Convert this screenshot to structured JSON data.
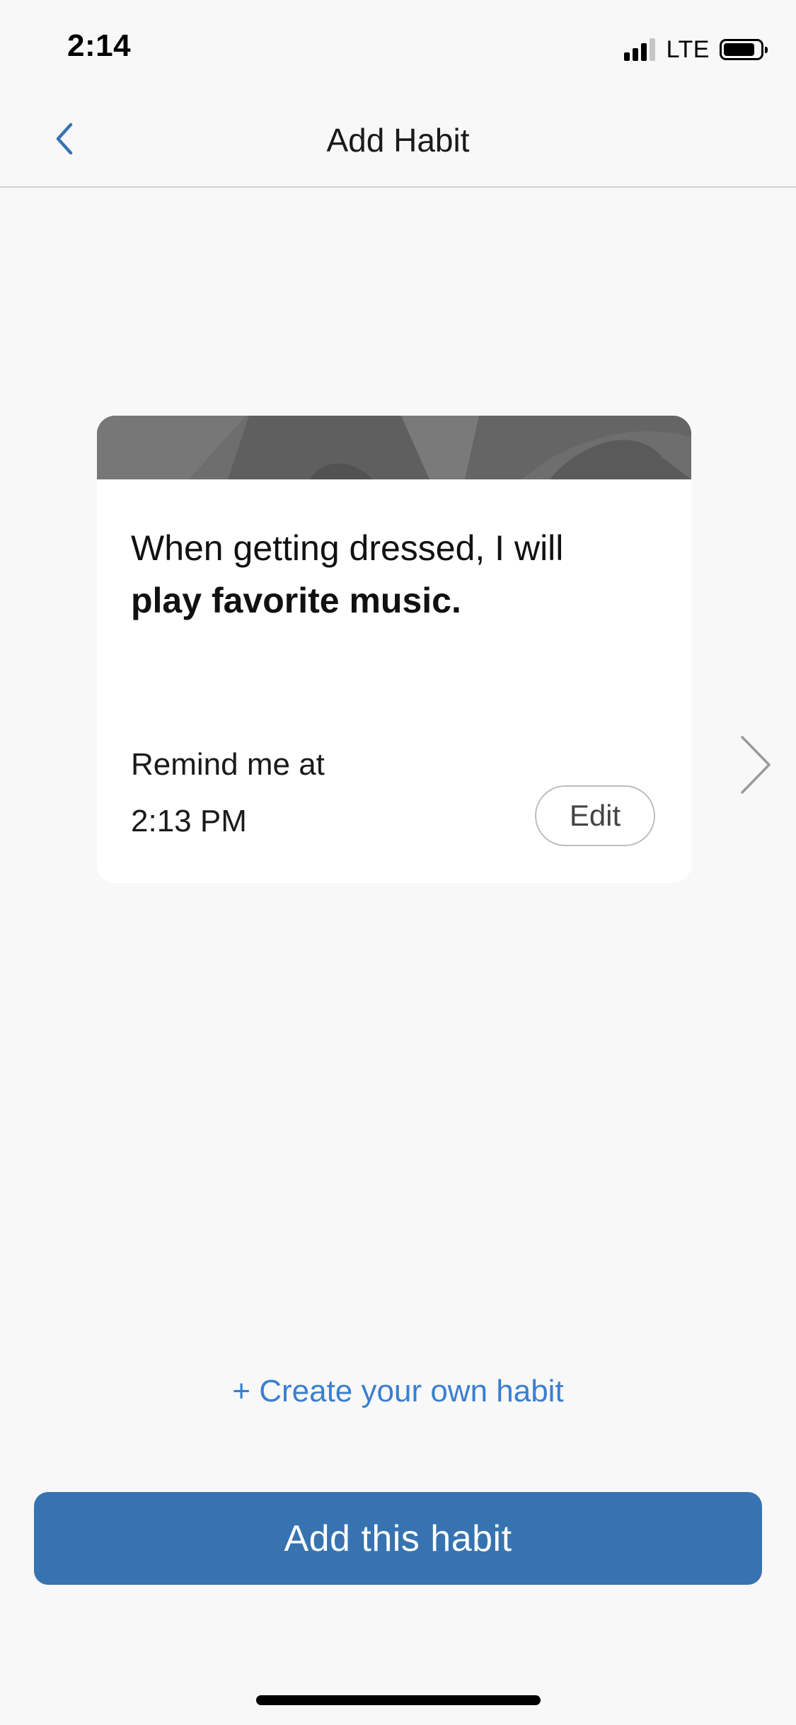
{
  "status_bar": {
    "time": "2:14",
    "network": "LTE",
    "signal_bars_active": 3,
    "signal_bars_total": 4,
    "battery_level": 0.85
  },
  "nav": {
    "title": "Add Habit",
    "back_icon": "chevron-left-icon"
  },
  "card": {
    "trigger": "When getting dressed, I will",
    "action": "play favorite music.",
    "remind_label": "Remind me at",
    "remind_time": "2:13 PM",
    "edit_label": "Edit",
    "banner_color": "#6e6e6e"
  },
  "next_icon": "chevron-right-icon",
  "create_link": "+ Create your own habit",
  "primary_button": {
    "label": "Add this habit",
    "color": "#3673b0"
  },
  "colors": {
    "accent": "#3a7fd0",
    "background": "#f8f8f8"
  }
}
